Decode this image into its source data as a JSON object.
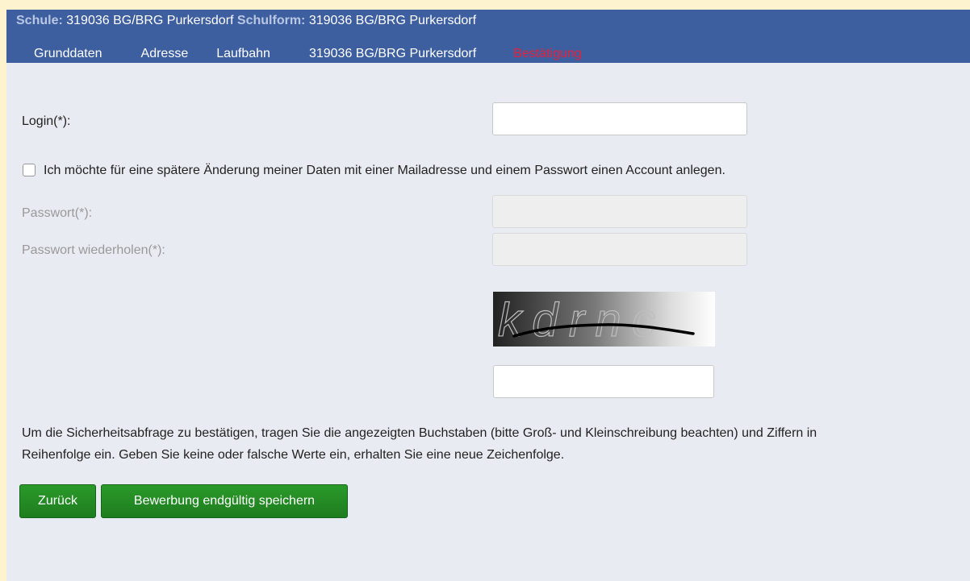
{
  "header": {
    "school_label": "Schule:",
    "school_value": "319036 BG/BRG Purkersdorf",
    "form_label": "Schulform:",
    "form_value": "319036 BG/BRG Purkersdorf"
  },
  "nav": {
    "items": [
      {
        "label": "Grunddaten",
        "active": false
      },
      {
        "label": "Adresse",
        "active": false
      },
      {
        "label": "Laufbahn",
        "active": false
      },
      {
        "label": "319036 BG/BRG Purkersdorf",
        "active": false
      },
      {
        "label": "Bestätigung",
        "active": true
      }
    ]
  },
  "form": {
    "login_label": "Login(*):",
    "login_value": "",
    "account_checkbox_label": "Ich möchte für eine spätere Änderung meiner Daten mit einer Mailadresse und einem Passwort einen Account anlegen.",
    "account_checked": false,
    "password_label": "Passwort(*):",
    "password_repeat_label": "Passwort wiederholen(*):",
    "captcha_text": "kdrnc",
    "captcha_input_value": ""
  },
  "note": {
    "line1": "Um die Sicherheitsabfrage zu bestätigen, tragen Sie die angezeigten Buchstaben (bitte Groß- und Kleinschreibung beachten) und Ziffern in",
    "line2": "Reihenfolge ein. Geben Sie keine oder falsche Werte ein, erhalten Sie eine neue Zeichenfolge."
  },
  "buttons": {
    "back": "Zurück",
    "save": "Bewerbung endgültig speichern"
  },
  "colors": {
    "header_bg": "#3d5fa0",
    "active_nav": "#e8213a",
    "button_green": "#1e7d1e",
    "page_bg": "#e8ebf2",
    "outer_bg": "#fdf3cf"
  }
}
